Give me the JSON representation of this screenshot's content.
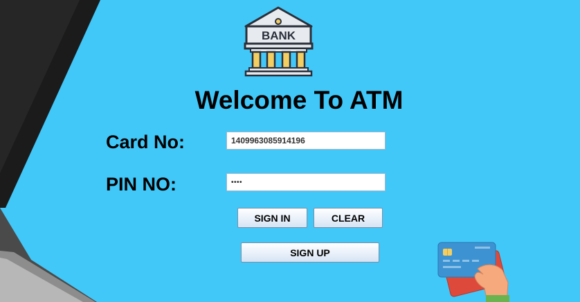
{
  "login": {
    "title": "Welcome To ATM",
    "card_label": "Card No:",
    "card_value": "1409963085914196",
    "pin_label": "PIN NO:",
    "pin_value": "••••"
  },
  "buttons": {
    "sign_in": "SIGN IN",
    "clear": "CLEAR",
    "sign_up": "SIGN UP"
  },
  "logo": {
    "text": "BANK"
  },
  "colors": {
    "background": "#41c8f8",
    "pillar": "#f3cf63",
    "card_blue": "#3d93d2",
    "card_red": "#dd4a3c",
    "hand": "#f5a97d",
    "sleeve": "#6ab34f"
  },
  "icons": [
    "bank-building-icon",
    "credit-card-hand-icon"
  ]
}
